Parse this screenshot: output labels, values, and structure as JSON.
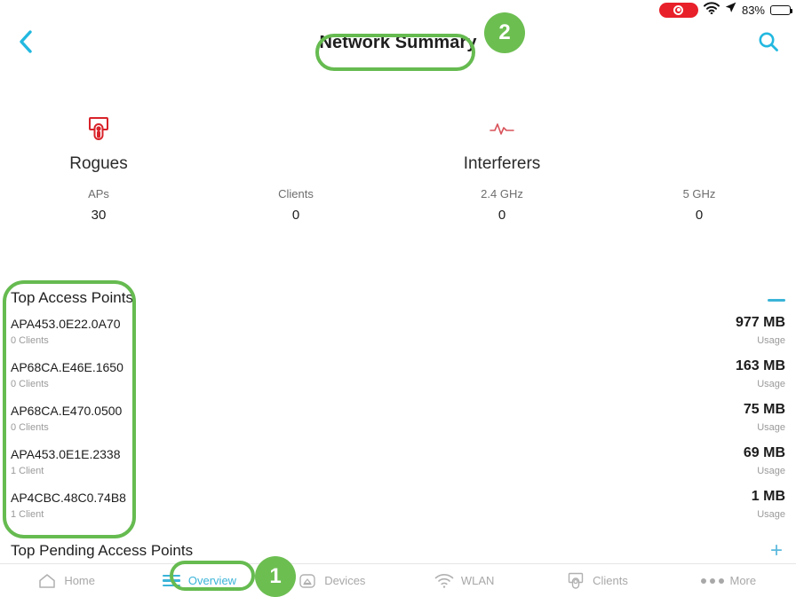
{
  "statusbar": {
    "left_text": "",
    "recording_icon": "record-indicator",
    "wifi_icon": "wifi-icon",
    "location_icon": "location-arrow-icon",
    "battery_text": "83%"
  },
  "navbar": {
    "back_icon": "chevron-left-icon",
    "title": "Network Summary",
    "search_icon": "search-icon"
  },
  "annotations": [
    {
      "id": "badge-2",
      "label": "2",
      "target": "Network Summary title"
    },
    {
      "id": "badge-1",
      "label": "1",
      "target": "Overview tab"
    }
  ],
  "colors": {
    "accent_cyan": "#3bb4d8",
    "annotation_green": "#6cbe51",
    "alert_red": "#e8202a",
    "muted_text": "#9a9a9a"
  },
  "summary": {
    "cards": [
      {
        "icon": "rogues-icon",
        "name": "Rogues",
        "label": "APs",
        "value": "30"
      },
      {
        "icon": "",
        "name": "",
        "label": "Clients",
        "value": "0"
      },
      {
        "icon": "interferers-icon",
        "name": "Interferers",
        "label": "2.4 GHz",
        "value": "0"
      },
      {
        "icon": "",
        "name": "",
        "label": "5 GHz",
        "value": "0"
      }
    ]
  },
  "top_access_points": {
    "title": "Top Access Points",
    "collapse_icon": "minus-icon",
    "usage_label": "Usage",
    "rows": [
      {
        "name": "APA453.0E22.0A70",
        "clients": "0 Clients",
        "usage": "977 MB",
        "usage_label": "Usage"
      },
      {
        "name": "AP68CA.E46E.1650",
        "clients": "0 Clients",
        "usage": "163 MB",
        "usage_label": "Usage"
      },
      {
        "name": "AP68CA.E470.0500",
        "clients": "0 Clients",
        "usage": "75 MB",
        "usage_label": "Usage"
      },
      {
        "name": "APA453.0E1E.2338",
        "clients": "1 Client",
        "usage": "69 MB",
        "usage_label": "Usage"
      },
      {
        "name": "AP4CBC.48C0.74B8",
        "clients": "1 Client",
        "usage": "1 MB",
        "usage_label": "Usage"
      }
    ]
  },
  "top_pending_access_points": {
    "title": "Top Pending Access Points",
    "expand_icon": "plus-icon",
    "expand_label": "+"
  },
  "tabbar": {
    "tabs": [
      {
        "label": "Home",
        "icon": "home-icon",
        "active": false
      },
      {
        "label": "Overview",
        "icon": "list-icon",
        "active": true
      },
      {
        "label": "Devices",
        "icon": "devices-icon",
        "active": false
      },
      {
        "label": "WLAN",
        "icon": "wifi-icon",
        "active": false
      },
      {
        "label": "Clients",
        "icon": "clients-icon",
        "active": false
      },
      {
        "label": "More",
        "icon": "ellipsis-icon",
        "active": false
      }
    ]
  }
}
